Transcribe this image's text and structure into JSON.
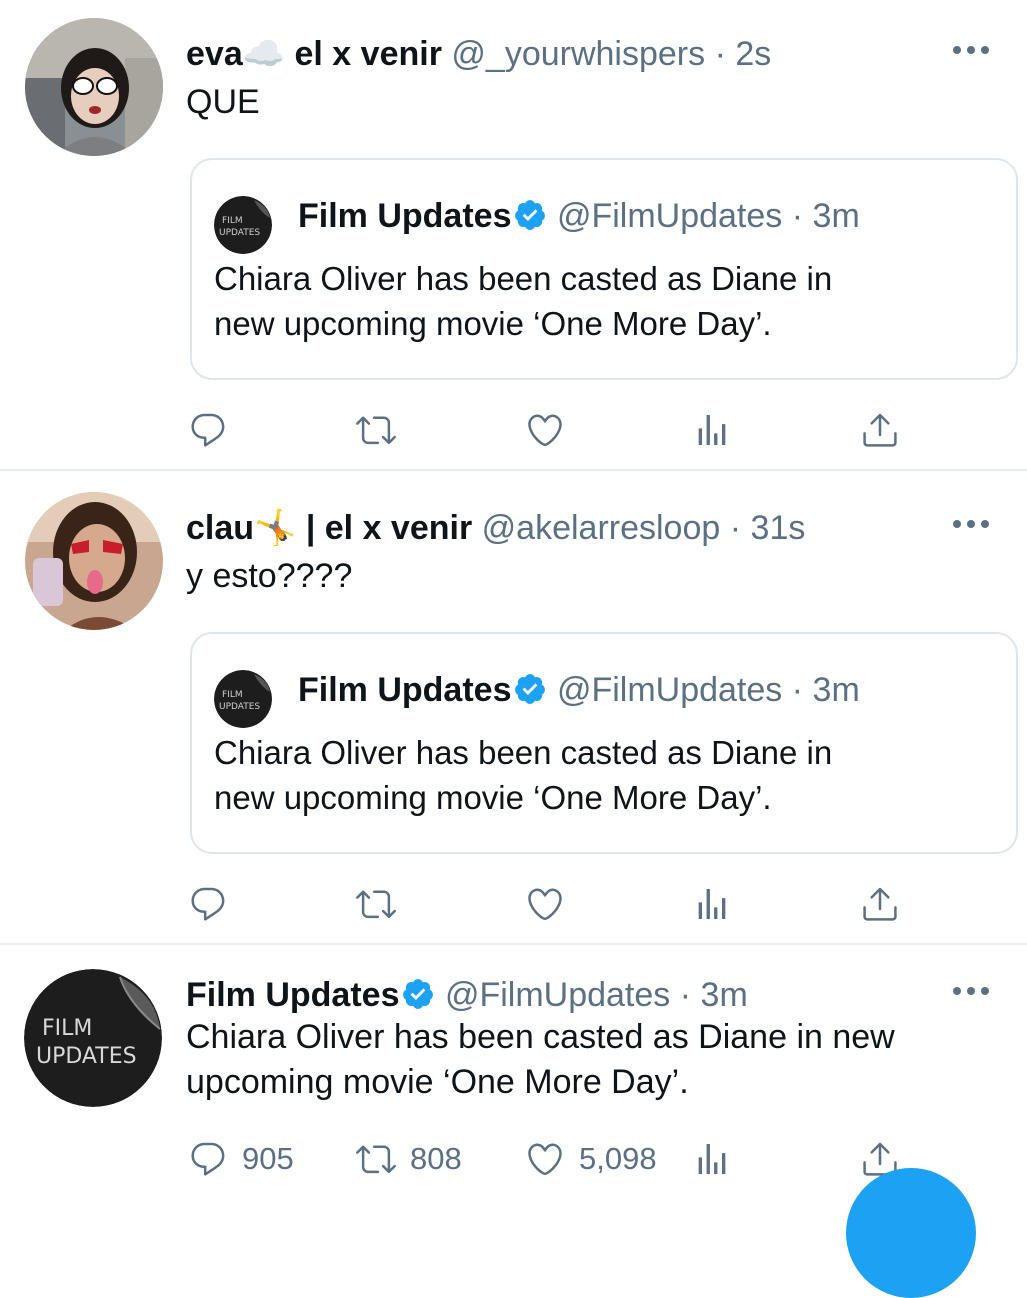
{
  "tweets": [
    {
      "name": "eva☁️ el x venir",
      "handle": "@_yourwhispers",
      "dot": "·",
      "time": "2s",
      "text": "QUE",
      "quote": {
        "name": "Film Updates",
        "handle": "@FilmUpdates",
        "dot": "·",
        "time": "3m",
        "line1": "Chiara Oliver has been casted as Diane in",
        "line2": "new upcoming movie ‘One More Day’."
      }
    },
    {
      "name": "clau🤸 | el x venir",
      "handle": "@akelarresloop",
      "dot": "·",
      "time": "31s",
      "text": "y esto????",
      "quote": {
        "name": "Film Updates",
        "handle": "@FilmUpdates",
        "dot": "·",
        "time": "3m",
        "line1": "Chiara Oliver has been casted as Diane in",
        "line2": "new upcoming movie ‘One More Day’."
      }
    },
    {
      "name": "Film Updates",
      "handle": "@FilmUpdates",
      "dot": "·",
      "time": "3m",
      "line1": "Chiara Oliver has been casted as Diane in new",
      "line2": "upcoming movie ‘One More Day’.",
      "replies": "905",
      "retweets": "808",
      "likes": "5,098"
    }
  ],
  "logo_text": {
    "top": "FILM",
    "bottom": "UPDATES"
  },
  "colors": {
    "accent": "#1da1f2",
    "secondary_text": "#5b7083",
    "border": "#dfe5ea",
    "verified": "#1da1f2"
  },
  "icons": [
    "reply-icon",
    "retweet-icon",
    "like-icon",
    "analytics-icon",
    "share-icon",
    "more-icon",
    "verified-icon"
  ]
}
